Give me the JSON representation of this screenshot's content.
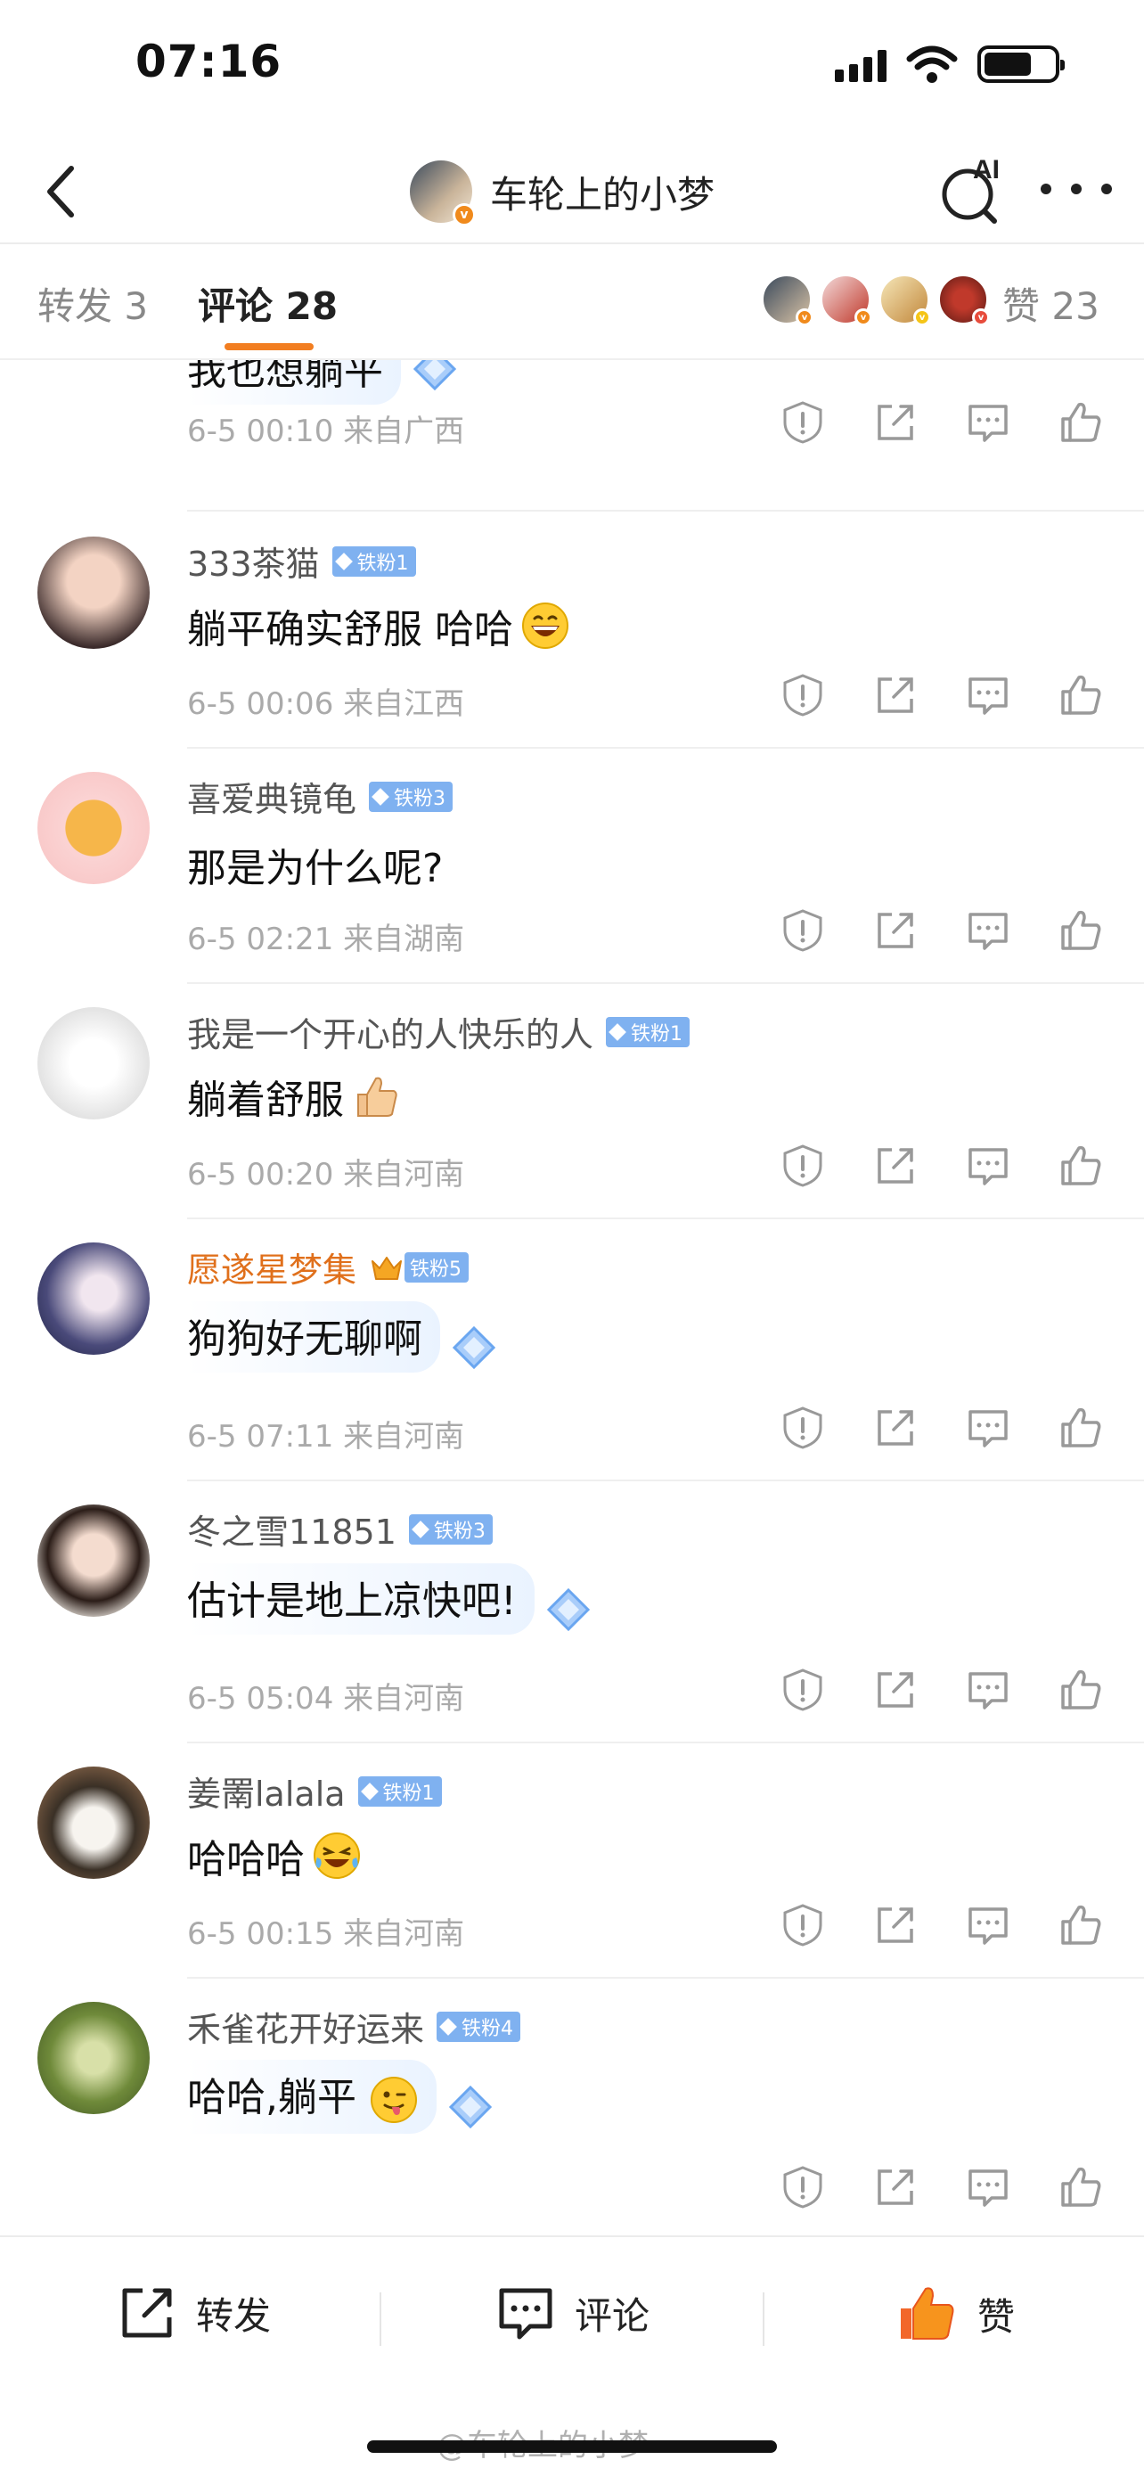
{
  "status_bar": {
    "time": "07:16"
  },
  "nav": {
    "title": "车轮上的小梦",
    "ai_label": "AI"
  },
  "tabs": {
    "repost": "转发 3",
    "comment": "评论 28",
    "likes": "赞 23"
  },
  "comments": [
    {
      "name": "",
      "text": "我也想躺平",
      "meta": "6-5 00:10 来自广西"
    },
    {
      "name": "333茶猫",
      "badge": "铁粉1",
      "text": "躺平确实舒服 哈哈",
      "meta": "6-5 00:06 来自江西"
    },
    {
      "name": "喜爱典镜龟",
      "badge": "铁粉3",
      "text": "那是为什么呢?",
      "meta": "6-5 02:21 来自湖南"
    },
    {
      "name": "我是一个开心的人快乐的人",
      "badge": "铁粉1",
      "text": "躺着舒服",
      "meta": "6-5 00:20 来自河南"
    },
    {
      "name": "愿遂星梦集",
      "badge": "铁粉5",
      "text": "狗狗好无聊啊",
      "meta": "6-5 07:11 来自河南"
    },
    {
      "name": "冬之雪11851",
      "badge": "铁粉3",
      "text": "估计是地上凉快吧!",
      "meta": "6-5 05:04 来自河南"
    },
    {
      "name": "姜罱lalala",
      "badge": "铁粉1",
      "text": "哈哈哈",
      "meta": "6-5 00:15 来自河南"
    },
    {
      "name": "禾雀花开好运来",
      "badge": "铁粉4",
      "text": "哈哈,躺平",
      "meta": ""
    }
  ],
  "bottom_bar": {
    "repost": "转发",
    "comment": "评论",
    "like": "赞"
  },
  "watermark": "@车轮上的小梦",
  "colors": {
    "accent": "#f27e21",
    "fan_badge": "#7fb1f0",
    "gold_name": "#e0701c"
  }
}
